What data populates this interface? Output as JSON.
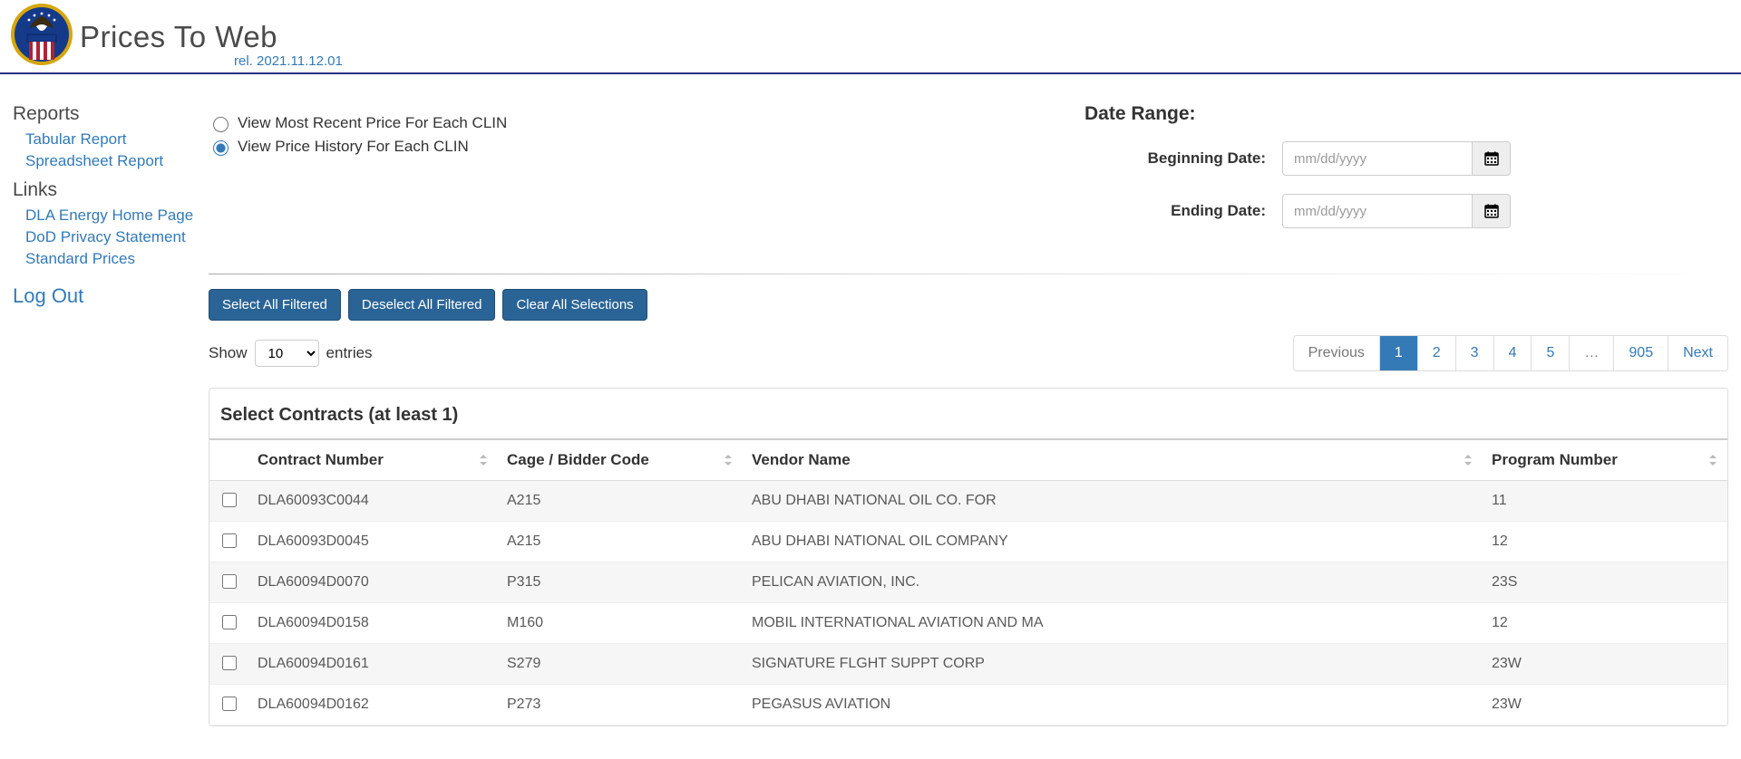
{
  "header": {
    "title": "Prices To Web",
    "release": "rel. 2021.11.12.01"
  },
  "sidebar": {
    "reports_heading": "Reports",
    "reports_links": [
      "Tabular Report",
      "Spreadsheet Report"
    ],
    "links_heading": "Links",
    "links_links": [
      "DLA Energy Home Page",
      "DoD Privacy Statement",
      "Standard Prices"
    ],
    "logout": "Log Out"
  },
  "view_options": {
    "opt_recent": "View Most Recent Price For Each CLIN",
    "opt_history": "View Price History For Each CLIN",
    "selected": "history"
  },
  "date_range": {
    "heading": "Date Range:",
    "begin_label": "Beginning Date:",
    "end_label": "Ending Date:",
    "placeholder": "mm/dd/yyyy"
  },
  "buttons": {
    "select_all": "Select All Filtered",
    "deselect_all": "Deselect All Filtered",
    "clear_all": "Clear All Selections"
  },
  "entries": {
    "show_label": "Show",
    "entries_label": "entries",
    "value": "10"
  },
  "pagination": {
    "previous": "Previous",
    "next": "Next",
    "ellipsis": "…",
    "pages": [
      "1",
      "2",
      "3",
      "4",
      "5"
    ],
    "last": "905",
    "current": "1"
  },
  "table": {
    "panel_title": "Select Contracts (at least 1)",
    "headers": {
      "contract": "Contract Number",
      "cage": "Cage / Bidder Code",
      "vendor": "Vendor Name",
      "program": "Program Number"
    },
    "rows": [
      {
        "contract": "DLA60093C0044",
        "cage": "A215",
        "vendor": "ABU DHABI NATIONAL OIL CO. FOR",
        "program": "11"
      },
      {
        "contract": "DLA60093D0045",
        "cage": "A215",
        "vendor": "ABU DHABI NATIONAL OIL COMPANY",
        "program": "12"
      },
      {
        "contract": "DLA60094D0070",
        "cage": "P315",
        "vendor": "PELICAN AVIATION, INC.",
        "program": "23S"
      },
      {
        "contract": "DLA60094D0158",
        "cage": "M160",
        "vendor": "MOBIL INTERNATIONAL AVIATION AND MA",
        "program": "12"
      },
      {
        "contract": "DLA60094D0161",
        "cage": "S279",
        "vendor": "SIGNATURE FLGHT SUPPT CORP",
        "program": "23W"
      },
      {
        "contract": "DLA60094D0162",
        "cage": "P273",
        "vendor": "PEGASUS AVIATION",
        "program": "23W"
      }
    ]
  }
}
